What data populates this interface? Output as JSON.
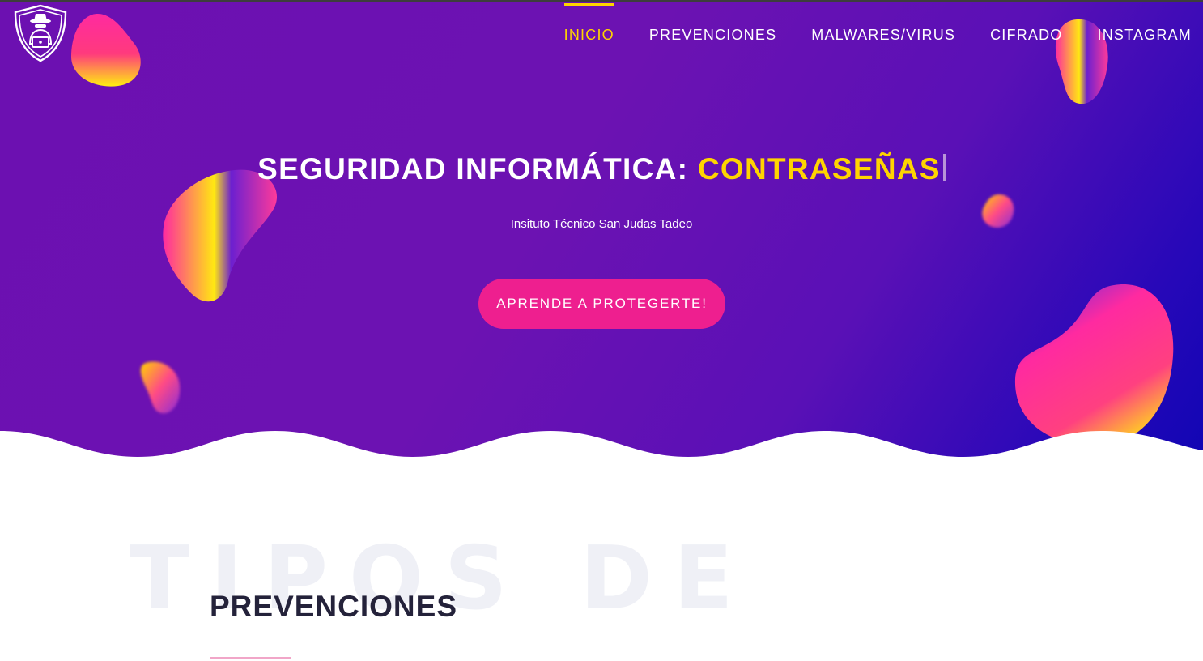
{
  "nav": {
    "items": [
      {
        "label": "INICIO",
        "active": true
      },
      {
        "label": "PREVENCIONES",
        "active": false
      },
      {
        "label": "MALWARES/VIRUS",
        "active": false
      },
      {
        "label": "CIFRADO",
        "active": false
      },
      {
        "label": "INSTAGRAM",
        "active": false
      }
    ]
  },
  "hero": {
    "title_prefix": "SEGURIDAD INFORMÁTICA: ",
    "title_highlight": "CONTRASEÑAS",
    "subtitle": "Insituto Técnico San Judas Tadeo",
    "cta_label": "APRENDE A PROTEGERTE!"
  },
  "section": {
    "background_text": "TIPOS DE",
    "title": "PREVENCIONES"
  },
  "colors": {
    "accent_yellow": "#ffd400",
    "cta_pink": "#ee1f8f",
    "hero_purple": "#6c10b1",
    "hero_blue": "#1105b4"
  },
  "icons": {
    "logo": "hacker-shield-icon",
    "decor": "gradient-blob"
  }
}
